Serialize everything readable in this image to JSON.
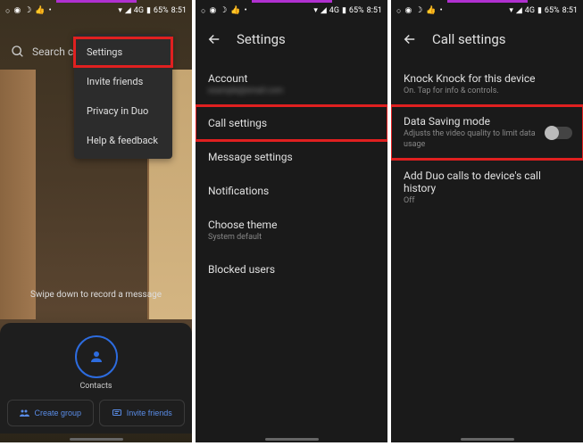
{
  "status": {
    "signal": "4G",
    "battery": "65%",
    "time": "8:51"
  },
  "panel1": {
    "search_placeholder": "Search co",
    "menu": {
      "settings": "Settings",
      "invite": "Invite friends",
      "privacy": "Privacy in Duo",
      "help": "Help & feedback"
    },
    "swipe_hint": "Swipe down to record a message",
    "contacts_label": "Contacts",
    "create_group": "Create group",
    "invite_friends": "Invite friends"
  },
  "panel2": {
    "title": "Settings",
    "items": {
      "account": "Account",
      "account_sub": "example@email.com",
      "call_settings": "Call settings",
      "message_settings": "Message settings",
      "notifications": "Notifications",
      "choose_theme": "Choose theme",
      "choose_theme_sub": "System default",
      "blocked_users": "Blocked users"
    }
  },
  "panel3": {
    "title": "Call settings",
    "knock": {
      "title": "Knock Knock for this device",
      "sub": "On. Tap for info & controls."
    },
    "data_saving": {
      "title": "Data Saving mode",
      "sub": "Adjusts the video quality to limit data usage"
    },
    "history": {
      "title": "Add Duo calls to device's call history",
      "sub": "Off"
    }
  }
}
